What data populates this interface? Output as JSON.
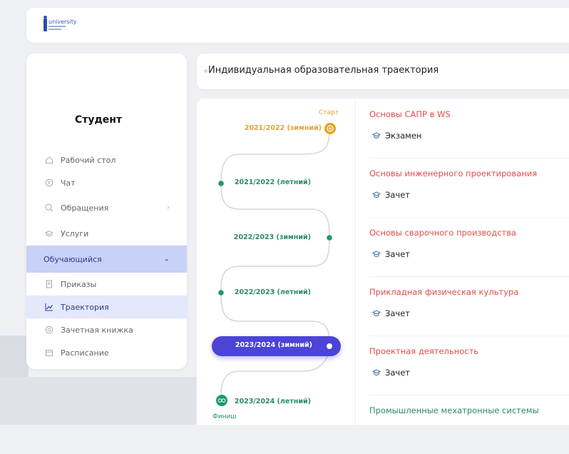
{
  "header": {
    "logo_text": "university"
  },
  "sidebar": {
    "role": "Студент",
    "items": [
      {
        "label": "Рабочий стол",
        "icon": "home-icon"
      },
      {
        "label": "Чат",
        "icon": "chat-icon"
      },
      {
        "label": "Обращения",
        "icon": "appeal-icon"
      },
      {
        "label": "Услуги",
        "icon": "layers-icon"
      }
    ],
    "section": {
      "label": "Обучающийся"
    },
    "subitems": [
      {
        "label": "Приказы",
        "icon": "document-icon"
      },
      {
        "label": "Траектория",
        "icon": "chart-line-icon"
      },
      {
        "label": "Зачетная книжка",
        "icon": "badge-icon"
      },
      {
        "label": "Расписание",
        "icon": "calendar-icon"
      }
    ]
  },
  "page": {
    "title": "Индивидуальная образовательная траектория"
  },
  "trajectory": {
    "start_label": "Старт",
    "finish_label": "Финиш",
    "semesters": [
      {
        "label": "2021/2022 (зимний)"
      },
      {
        "label": "2021/2022 (летний)"
      },
      {
        "label": "2022/2023 (зимний)"
      },
      {
        "label": "2022/2023 (летний)"
      },
      {
        "label": "2023/2024 (зимний)"
      },
      {
        "label": "2023/2024 (летний)"
      }
    ],
    "colors": {
      "start": "#e8a321",
      "done": "#1e9a6a",
      "active": "#4b44d6",
      "path": "#d5d8de"
    }
  },
  "courses": [
    {
      "name": "Основы САПР в WS",
      "type": "Экзамен"
    },
    {
      "name": "Основы инженерного проектирования",
      "type": "Зачет"
    },
    {
      "name": "Основы сварочного производства",
      "type": "Зачет"
    },
    {
      "name": "Прикладная физическая культура",
      "type": "Зачет"
    },
    {
      "name": "Проектная деятельность",
      "type": "Зачет"
    },
    {
      "name": "Промышленные мехатронные системы",
      "type": ""
    }
  ]
}
